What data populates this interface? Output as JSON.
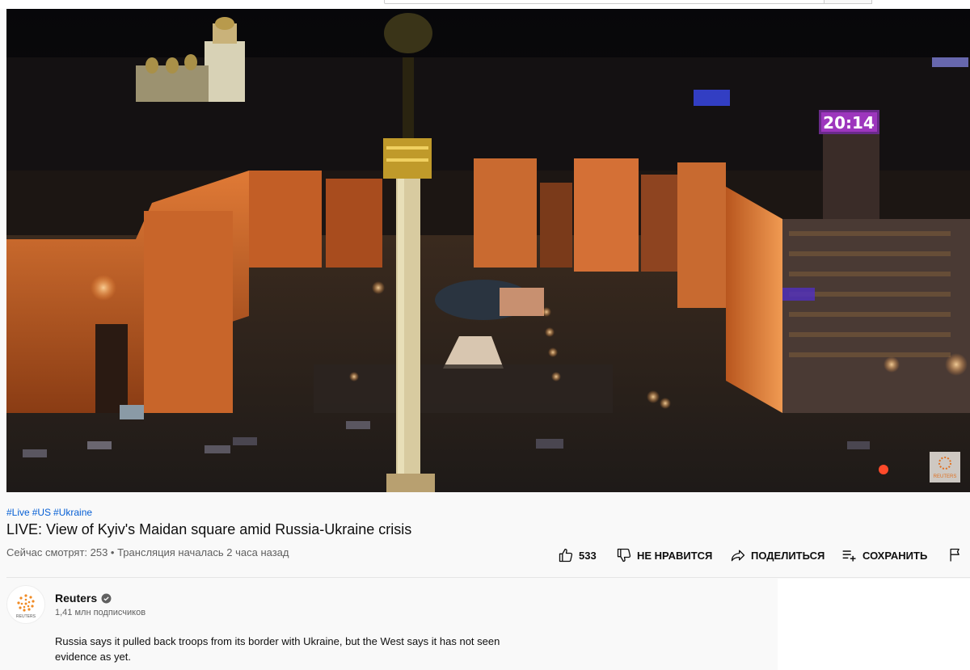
{
  "player": {
    "clock_display": "20:14",
    "watermark": "REUTERS"
  },
  "tags": [
    "#Live",
    "#US",
    "#Ukraine"
  ],
  "video": {
    "title": "LIVE: View of Kyiv's Maidan square amid Russia-Ukraine crisis",
    "view_info": "Сейчас смотрят: 253 • Трансляция началась 2 часа назад"
  },
  "actions": {
    "like_count": "533",
    "dislike_label": "НЕ НРАВИТСЯ",
    "share_label": "ПОДЕЛИТЬСЯ",
    "save_label": "СОХРАНИТЬ"
  },
  "channel": {
    "name": "Reuters",
    "avatar_text": "REUTERS",
    "subscribers": "1,41 млн подписчиков"
  },
  "description": "Russia says it pulled back troops from its border with Ukraine, but the West says it has not seen evidence as yet."
}
